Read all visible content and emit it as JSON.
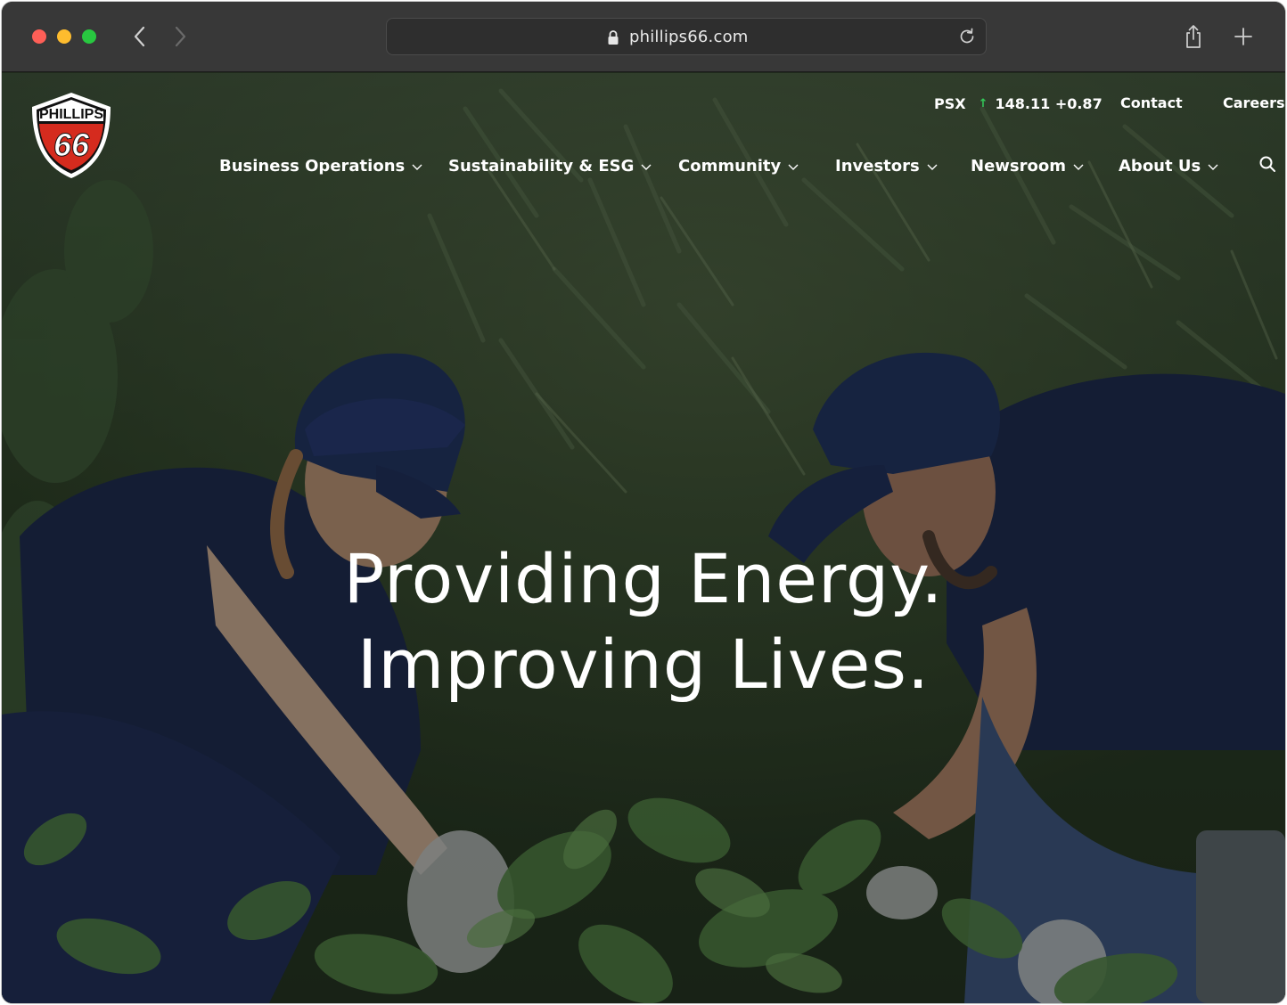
{
  "browser": {
    "url": "phillips66.com"
  },
  "brand": {
    "logo_word": "PHILLIPS",
    "logo_number": "66",
    "logo_red": "#d52b1e"
  },
  "utility_bar": {
    "ticker": "PSX",
    "price_change": "148.11 +0.87",
    "contact": "Contact",
    "careers": "Careers"
  },
  "nav": {
    "items": [
      {
        "label": "Business Operations"
      },
      {
        "label": "Sustainability & ESG"
      },
      {
        "label": "Community"
      },
      {
        "label": "Investors"
      },
      {
        "label": "Newsroom"
      },
      {
        "label": "About Us"
      }
    ]
  },
  "hero": {
    "line1": "Providing Energy.",
    "line2": "Improving Lives."
  },
  "icons": {
    "back": "chevron-left-icon",
    "forward": "chevron-right-icon",
    "lock": "lock-icon",
    "reload": "reload-icon",
    "share": "share-icon",
    "new_tab": "plus-icon",
    "search": "search-icon",
    "up_arrow": "arrow-up-icon"
  }
}
